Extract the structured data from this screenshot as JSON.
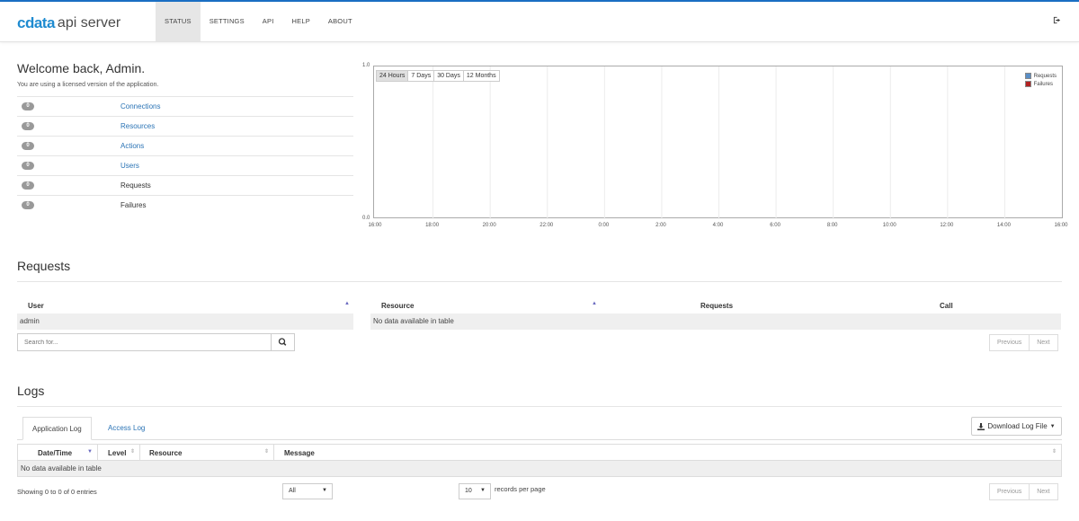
{
  "header": {
    "logo_brand": "cdata",
    "logo_product": "api server",
    "nav": [
      {
        "label": "STATUS",
        "active": true
      },
      {
        "label": "SETTINGS",
        "active": false
      },
      {
        "label": "API",
        "active": false
      },
      {
        "label": "HELP",
        "active": false
      },
      {
        "label": "ABOUT",
        "active": false
      }
    ],
    "logout_icon": "logout-icon"
  },
  "welcome": {
    "title": "Welcome back, Admin.",
    "subtitle": "You are using a licensed version of the application."
  },
  "stats": [
    {
      "count": "0",
      "label": "Connections",
      "link": true
    },
    {
      "count": "0",
      "label": "Resources",
      "link": true
    },
    {
      "count": "0",
      "label": "Actions",
      "link": true
    },
    {
      "count": "0",
      "label": "Users",
      "link": true
    },
    {
      "count": "0",
      "label": "Requests",
      "link": false
    },
    {
      "count": "0",
      "label": "Failures",
      "link": false
    }
  ],
  "chart": {
    "range_buttons": [
      "24 Hours",
      "7 Days",
      "30 Days",
      "12 Months"
    ],
    "active_range": "24 Hours",
    "legend": [
      {
        "name": "Requests",
        "color": "#5a8ec6"
      },
      {
        "name": "Failures",
        "color": "#b22222"
      }
    ]
  },
  "chart_data": {
    "type": "bar",
    "x": [
      "16:00",
      "18:00",
      "20:00",
      "22:00",
      "0:00",
      "2:00",
      "4:00",
      "6:00",
      "8:00",
      "10:00",
      "12:00",
      "14:00",
      "16:00"
    ],
    "series": [
      {
        "name": "Requests",
        "values": []
      },
      {
        "name": "Failures",
        "values": []
      }
    ],
    "ylim": [
      0.0,
      1.0
    ],
    "y_ticks": [
      "0.0",
      "1.0"
    ],
    "grid": true,
    "legend_position": "top-right"
  },
  "requests": {
    "title": "Requests",
    "users_table": {
      "header": "User",
      "rows": [
        "admin"
      ]
    },
    "resource_table": {
      "headers": [
        "Resource",
        "Requests",
        "Call"
      ],
      "empty_text": "No data available in table"
    },
    "search_placeholder": "Search for...",
    "pager": {
      "previous": "Previous",
      "next": "Next"
    }
  },
  "logs": {
    "title": "Logs",
    "tabs": [
      {
        "label": "Application Log",
        "active": true
      },
      {
        "label": "Access Log",
        "active": false
      }
    ],
    "download_button": "Download Log File",
    "headers": [
      "Date/Time",
      "Level",
      "Resource",
      "Message"
    ],
    "empty_text": "No data available in table",
    "showing": "Showing 0 to 0 of 0 entries",
    "filter_select": "All",
    "page_size": "10",
    "page_size_suffix": "records per page",
    "pager": {
      "previous": "Previous",
      "next": "Next"
    }
  }
}
